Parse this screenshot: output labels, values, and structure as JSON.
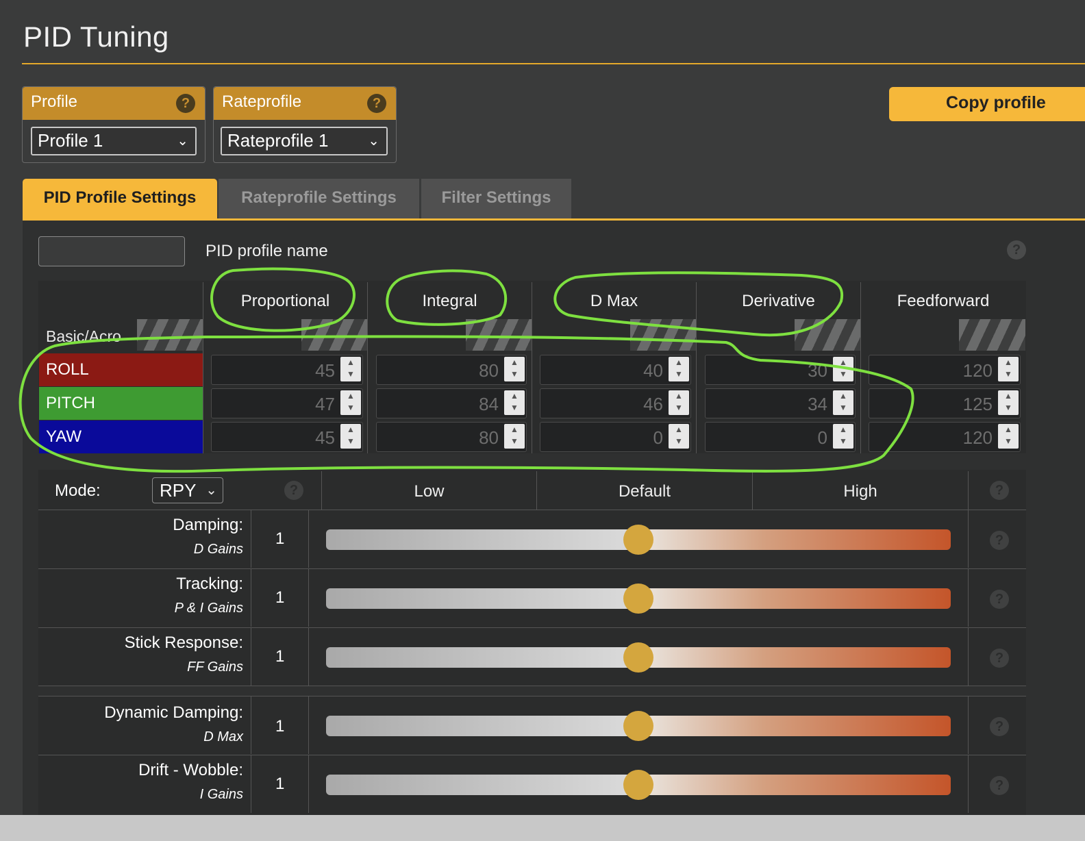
{
  "page": {
    "title": "PID Tuning"
  },
  "profile": {
    "label": "Profile",
    "help": "?",
    "selected": "Profile 1"
  },
  "rateprofile": {
    "label": "Rateprofile",
    "help": "?",
    "selected": "Rateprofile 1"
  },
  "copy_button": "Copy profile",
  "tabs": [
    {
      "label": "PID Profile Settings",
      "active": true
    },
    {
      "label": "Rateprofile Settings",
      "active": false
    },
    {
      "label": "Filter Settings",
      "active": false
    }
  ],
  "pid_profile_name": {
    "label": "PID profile name",
    "value": "",
    "help": "?"
  },
  "pid_table": {
    "columns": [
      "Proportional",
      "Integral",
      "D Max",
      "Derivative",
      "Feedforward"
    ],
    "section_label": "Basic/Acro",
    "rows": [
      {
        "axis": "ROLL",
        "color": "#8b1a14",
        "values": [
          "45",
          "80",
          "40",
          "30",
          "120"
        ]
      },
      {
        "axis": "PITCH",
        "color": "#3e9b32",
        "values": [
          "47",
          "84",
          "46",
          "34",
          "125"
        ]
      },
      {
        "axis": "YAW",
        "color": "#0a0a9a",
        "values": [
          "45",
          "80",
          "0",
          "0",
          "120"
        ]
      }
    ]
  },
  "sliders": {
    "mode_label": "Mode:",
    "mode_value": "RPY",
    "headers": {
      "low": "Low",
      "default": "Default",
      "high": "High"
    },
    "help": "?",
    "rows": [
      {
        "label": "Damping:",
        "sub": "D Gains",
        "value": "1",
        "level": 0.5
      },
      {
        "label": "Tracking:",
        "sub": "P & I Gains",
        "value": "1",
        "level": 0.5
      },
      {
        "label": "Stick Response:",
        "sub": "FF Gains",
        "value": "1",
        "level": 0.5
      },
      {
        "label": "Dynamic Damping:",
        "sub": "D Max",
        "value": "1",
        "level": 0.5
      },
      {
        "label": "Drift - Wobble:",
        "sub": "I Gains",
        "value": "1",
        "level": 0.5
      }
    ]
  },
  "colors": {
    "accent": "#f6b83a",
    "annotation": "#7ee040"
  }
}
